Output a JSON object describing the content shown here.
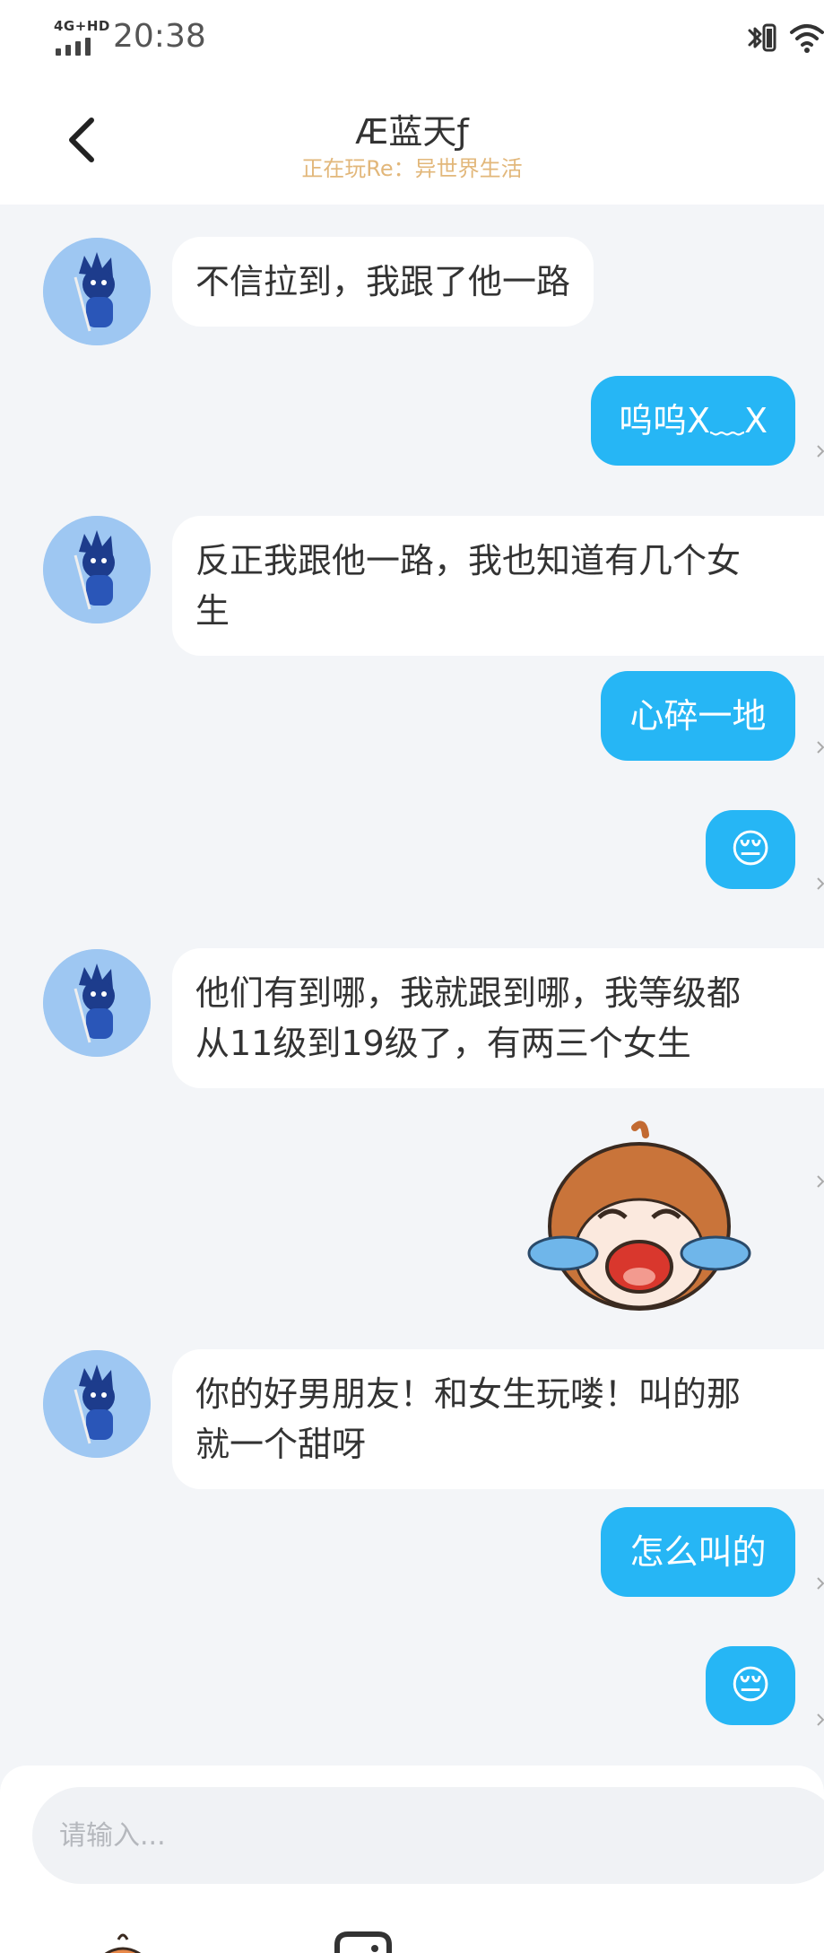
{
  "status_bar": {
    "network": "4G+HD",
    "time": "20:38"
  },
  "header": {
    "title": "Æ蓝天ƒ",
    "subtitle": "正在玩Re：异世界生活"
  },
  "messages": [
    {
      "side": "in",
      "text": "不信拉到，我跟了他一路"
    },
    {
      "side": "out",
      "text": "呜呜X﹏X"
    },
    {
      "side": "in",
      "lines": [
        "反正我跟他一路，我也知道有几个女",
        "生"
      ]
    },
    {
      "side": "out",
      "text": "心碎一地"
    },
    {
      "side": "out",
      "text": "😔"
    },
    {
      "side": "in",
      "lines": [
        "他们有到哪，我就跟到哪，我等级都",
        "从11级到19级了，有两三个女生"
      ]
    },
    {
      "side": "out",
      "type": "sticker",
      "sticker": "crying-orange-creature"
    },
    {
      "side": "in",
      "lines": [
        "你的好男朋友！和女生玩喽！叫的那",
        "就一个甜呀"
      ]
    },
    {
      "side": "out",
      "text": "怎么叫的"
    },
    {
      "side": "out",
      "text": "😔"
    }
  ],
  "composer": {
    "placeholder": "请输入..."
  },
  "colors": {
    "accent": "#26b6f5",
    "subtitle": "#e2b77a",
    "background": "#f3f5f8"
  }
}
